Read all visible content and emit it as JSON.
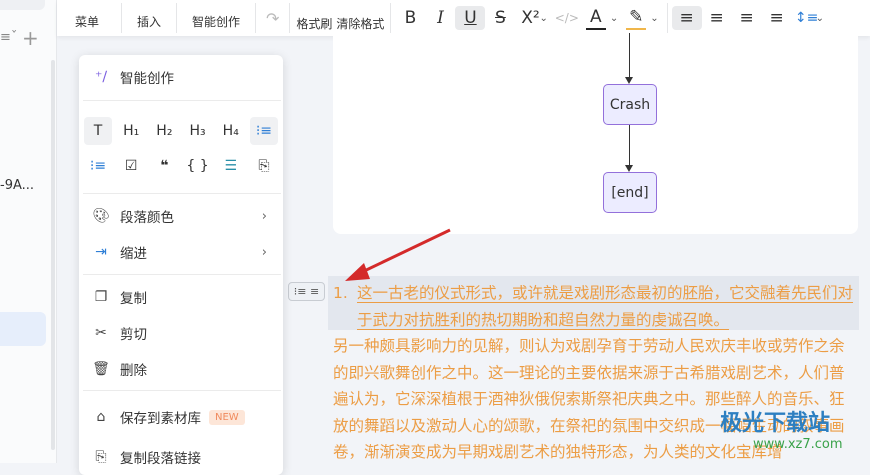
{
  "sidebar": {
    "suffix": "≡ˇ",
    "plus": "+",
    "doc_fragment": "-9A..."
  },
  "toolbar": {
    "menu": "菜单",
    "insert": "插入",
    "ai": "智能创作",
    "redo": "↷",
    "format_painter": "格式刷",
    "clear_format": "清除格式",
    "bold": "B",
    "italic": "I",
    "underline": "U",
    "strike": "S",
    "superscript": "X²",
    "code": "</>",
    "font_color": "A",
    "highlight": "✎",
    "align_left": "≡",
    "align_center": "≡",
    "align_right": "≡",
    "justify": "≡",
    "line_height": "↕≡"
  },
  "flowchart": {
    "nodes": [
      "Crash",
      "[end]"
    ]
  },
  "document": {
    "list_number": "1.",
    "list_item": "这一古老的仪式形式，或许就是戏剧形态最初的胚胎，它交融着先民们对于武力对抗胜利的热切期盼和超自然力量的虔诚召唤。",
    "paragraph": "另一种颇具影响力的见解，则认为戏剧孕育于劳动人民欢庆丰收或劳作之余的即兴歌舞创作之中。这一理论的主要依据来源于古希腊戏剧艺术，人们普遍认为，它深深植根于酒神狄俄倪索斯祭祀庆典之中。那些醉人的音乐、狂放的舞蹈以及激动人心的颂歌，在祭祀的氛围中交织成一幅幅生动的叙事画卷，渐渐演变成为早期戏剧艺术的独特形态，为人类的文化宝库增"
  },
  "block_handle": "⁝≡ ≡",
  "context_menu": {
    "ai": "智能创作",
    "blocks": [
      "T",
      "H₁",
      "H₂",
      "H₃",
      "H₄",
      "⁝≡",
      "⁝≡",
      "☑",
      "❝",
      "{ }",
      "☰",
      "⎘"
    ],
    "items": [
      {
        "label": "段落颜色",
        "icon": "palette-icon",
        "sub": true
      },
      {
        "label": "缩进",
        "icon": "indent-icon",
        "sub": true
      },
      {
        "label": "复制",
        "icon": "copy-icon"
      },
      {
        "label": "剪切",
        "icon": "scissors-icon"
      },
      {
        "label": "删除",
        "icon": "trash-icon"
      },
      {
        "label": "保存到素材库",
        "icon": "save-material-icon",
        "badge": "NEW"
      },
      {
        "label": "复制段落链接",
        "icon": "link-copy-icon"
      }
    ]
  },
  "watermark": {
    "brand": "极光下载站",
    "url": "www.xz7.com"
  },
  "colors": {
    "text": "#ec9d45",
    "node_fill": "#ececff",
    "node_border": "#9370db",
    "arrow": "#d42a2a"
  }
}
